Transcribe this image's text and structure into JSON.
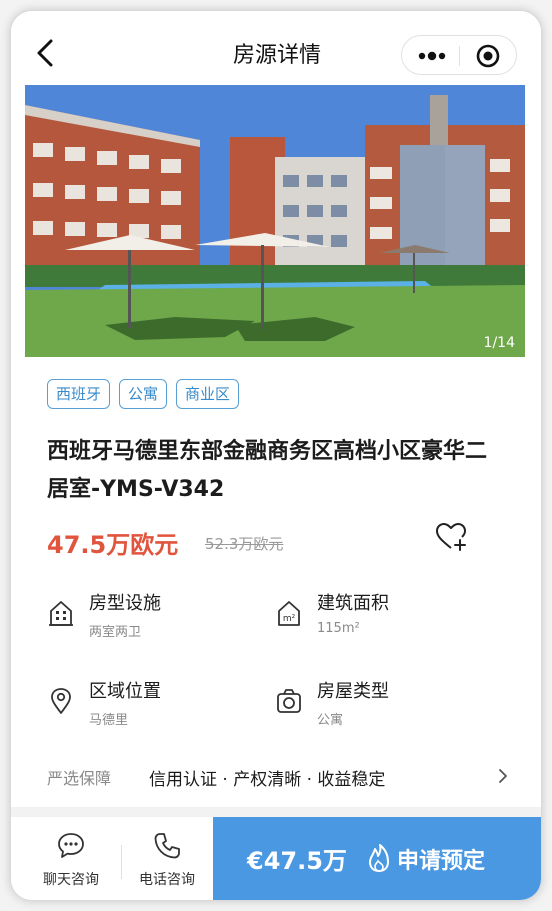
{
  "header": {
    "title": "房源详情",
    "back_icon": "back-arrow-icon",
    "more_icon": "more-dots-icon",
    "close_icon": "target-close-icon"
  },
  "gallery": {
    "counter": "1/14",
    "sky_color": "#4f86d8"
  },
  "tags": [
    "西班牙",
    "公寓",
    "商业区"
  ],
  "listing": {
    "title": "西班牙马德里东部金融商务区高档小区豪华二居室-YMS-V342",
    "price": "47.5万欧元",
    "original_price": "52.3万欧元",
    "favorite_icon": "heart-plus-icon"
  },
  "features": [
    {
      "label": "房型设施",
      "value": "两室两卫",
      "icon": "building-icon"
    },
    {
      "label": "建筑面积",
      "value": "115m²",
      "icon": "house-area-icon"
    },
    {
      "label": "区域位置",
      "value": "马德里",
      "icon": "location-pin-icon"
    },
    {
      "label": "房屋类型",
      "value": "公寓",
      "icon": "camera-icon"
    }
  ],
  "guarantee": {
    "label": "严选保障",
    "items": "信用认证 · 产权清晰 · 收益稳定"
  },
  "bottom_bar": {
    "chat_label": "聊天咨询",
    "phone_label": "电话咨询",
    "book_price": "€47.5万",
    "book_label": "申请预定",
    "accent_color": "#4a98e2",
    "price_color": "#e0553e"
  }
}
